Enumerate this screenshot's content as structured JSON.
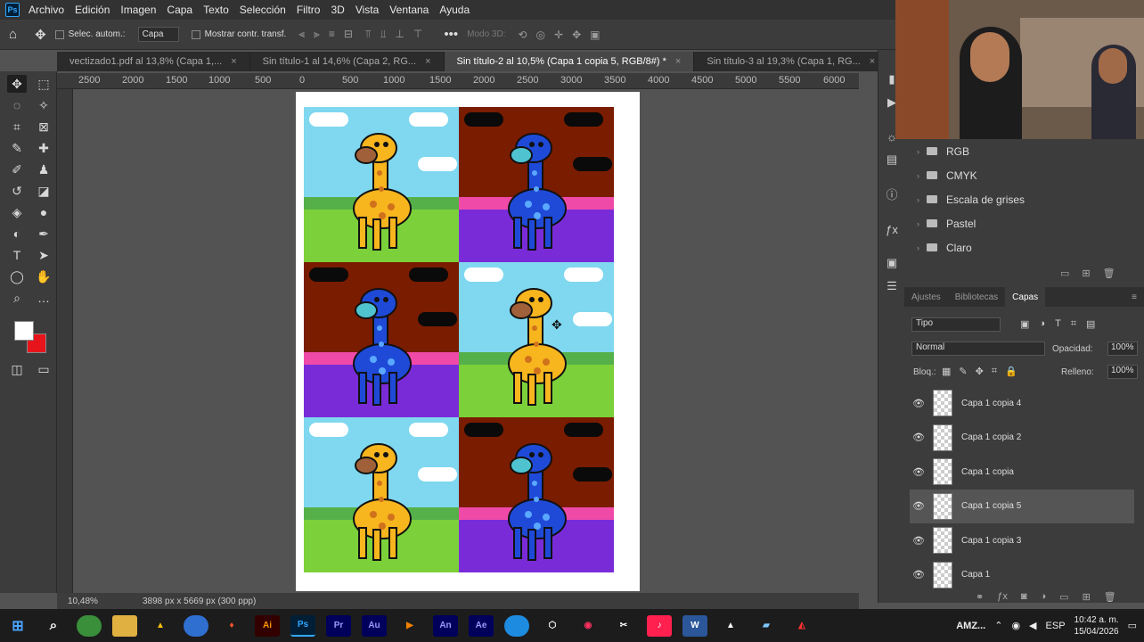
{
  "app": {
    "logo": "Ps",
    "menu": [
      "Archivo",
      "Edición",
      "Imagen",
      "Capa",
      "Texto",
      "Selección",
      "Filtro",
      "3D",
      "Vista",
      "Ventana",
      "Ayuda"
    ]
  },
  "options": {
    "auto_select": "Selec. autom.:",
    "target": "Capa",
    "show_transform": "Mostrar contr. transf.",
    "mode3d": "Modo 3D:"
  },
  "tabs": [
    {
      "label": "vectizado1.pdf al 13,8% (Capa 1,...",
      "active": false
    },
    {
      "label": "Sin título-1 al 14,6% (Capa 2, RG...",
      "active": false
    },
    {
      "label": "Sin título-2 al 10,5% (Capa 1 copia 5, RGB/8#) *",
      "active": true
    },
    {
      "label": "Sin título-3 al 19,3% (Capa 1, RG...",
      "active": false
    }
  ],
  "ruler": [
    "2500",
    "2000",
    "1500",
    "1000",
    "500",
    "0",
    "500",
    "1000",
    "1500",
    "2000",
    "2500",
    "3000",
    "3500",
    "4000",
    "4500",
    "5000",
    "5500",
    "6000"
  ],
  "status": {
    "zoom": "10,48%",
    "size": "3898 px x 5669 px (300 ppp)"
  },
  "swatch_groups": [
    "RGB",
    "CMYK",
    "Escala de grises",
    "Pastel",
    "Claro"
  ],
  "panel_tabs": [
    "Ajustes",
    "Bibliotecas",
    "Capas"
  ],
  "layers_panel": {
    "filter": "Tipo",
    "blend": "Normal",
    "opacity_label": "Opacidad:",
    "opacity": "100%",
    "lock_label": "Bloq.:",
    "fill_label": "Relleno:",
    "fill": "100%"
  },
  "layers": [
    {
      "name": "Capa 1 copia 4",
      "selected": false
    },
    {
      "name": "Capa 1 copia 2",
      "selected": false
    },
    {
      "name": "Capa 1 copia",
      "selected": false
    },
    {
      "name": "Capa 1 copia 5",
      "selected": true
    },
    {
      "name": "Capa 1 copia 3",
      "selected": false
    },
    {
      "name": "Capa 1",
      "selected": false
    }
  ],
  "taskbar": {
    "apps": [
      "Ai",
      "Ps",
      "Pr",
      "Au",
      "An",
      "Ae"
    ],
    "tray_text": "AMZ...",
    "lang": "ESP",
    "time": "10:42 a. m.",
    "date": "15/04/2026"
  },
  "colors": {
    "fg": "#ffffff",
    "bg": "#e8141b",
    "accent": "#31a8ff"
  }
}
